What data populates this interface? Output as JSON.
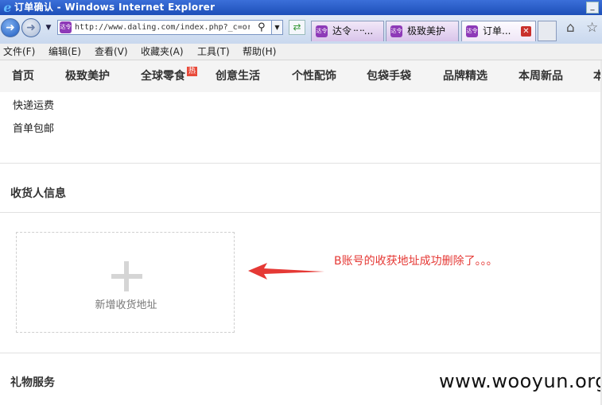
{
  "window": {
    "title": "订单确认 - Windows Internet Explorer",
    "minimize_label": "_"
  },
  "browser": {
    "url": "http://www.daling.com/index.php?_c=ord",
    "tabs": [
      {
        "label": "达令᠃᠃...",
        "active": false
      },
      {
        "label": "极致美护",
        "active": false
      },
      {
        "label": "订单...",
        "active": true
      }
    ],
    "favicon_text": "达令"
  },
  "menubar": {
    "items": [
      "文件(F)",
      "编辑(E)",
      "查看(V)",
      "收藏夹(A)",
      "工具(T)",
      "帮助(H)"
    ]
  },
  "site_nav": {
    "items": [
      "首页",
      "极致美护",
      "全球零食",
      "创意生活",
      "个性配饰",
      "包袋手袋",
      "品牌精选",
      "本周新品",
      "本"
    ],
    "hot_badge": "热"
  },
  "dropdown": {
    "items": [
      "快递运费",
      "首单包邮"
    ]
  },
  "sections": {
    "receiver_title": "收货人信息",
    "add_address_label": "新增收货地址",
    "gift_title": "礼物服务"
  },
  "annotation": {
    "text": "B账号的收获地址成功删除了。。。",
    "color": "#e53935"
  },
  "watermark": "www.wooyun.org",
  "colors": {
    "accent_red": "#e53935",
    "titlebar_blue": "#1d4fb8"
  }
}
